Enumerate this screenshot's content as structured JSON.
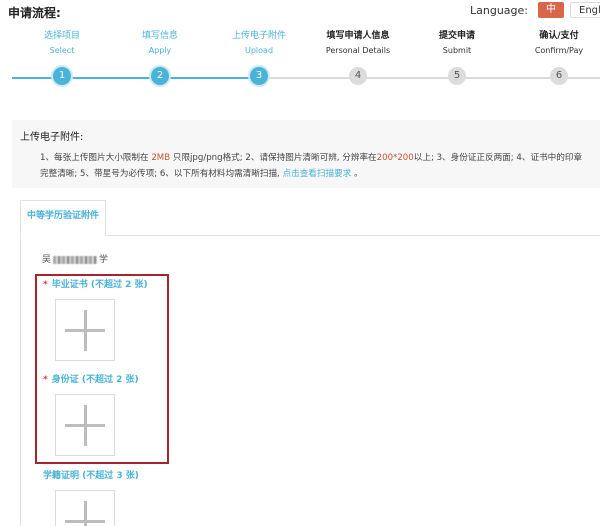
{
  "header": {
    "title": "申请流程:"
  },
  "language": {
    "label": "Language:",
    "options": [
      "中文",
      "English"
    ],
    "active": "中文"
  },
  "steps": [
    {
      "zh": "选择项目",
      "en": "Select",
      "num": "1",
      "state": "done"
    },
    {
      "zh": "填写信息",
      "en": "Apply",
      "num": "2",
      "state": "done"
    },
    {
      "zh": "上传电子附件",
      "en": "Upload",
      "num": "3",
      "state": "done"
    },
    {
      "zh": "填写申请人信息",
      "en": "Personal Details",
      "num": "4",
      "state": "todo"
    },
    {
      "zh": "提交申请",
      "en": "Submit",
      "num": "5",
      "state": "todo"
    },
    {
      "zh": "确认/支付",
      "en": "Confirm/Pay",
      "num": "6",
      "state": "todo"
    }
  ],
  "info": {
    "title": "上传电子附件:",
    "p1": "1、每张上传图片大小限制在",
    "size": "2MB",
    "p2": "只限jpg/png格式; 2、请保持图片清晰可辨, 分辨率在",
    "resolution": "200*200",
    "p3": "以上; 3、身份证正反两面; 4、证书中的印章",
    "p4": "完整清晰; 5、带星号为必传项; 6、以下所有材料均需清晰扫描,",
    "link": "点击查看扫描要求",
    "p5": "。"
  },
  "tab": {
    "label": "中等学历验证附件"
  },
  "school": {
    "prefix": "吴",
    "suffix": "学"
  },
  "uploads": [
    {
      "label": "毕业证书 (不超过 2 张)",
      "required": true
    },
    {
      "label": "身份证 (不超过 2 张)",
      "required": true
    },
    {
      "label": "学籍证明 (不超过 3 张)",
      "required": false
    }
  ],
  "colors": {
    "accent": "#4ab3d8",
    "lang_active": "#d9664a",
    "highlight_border": "#a4262c",
    "required": "#e03b3b"
  }
}
